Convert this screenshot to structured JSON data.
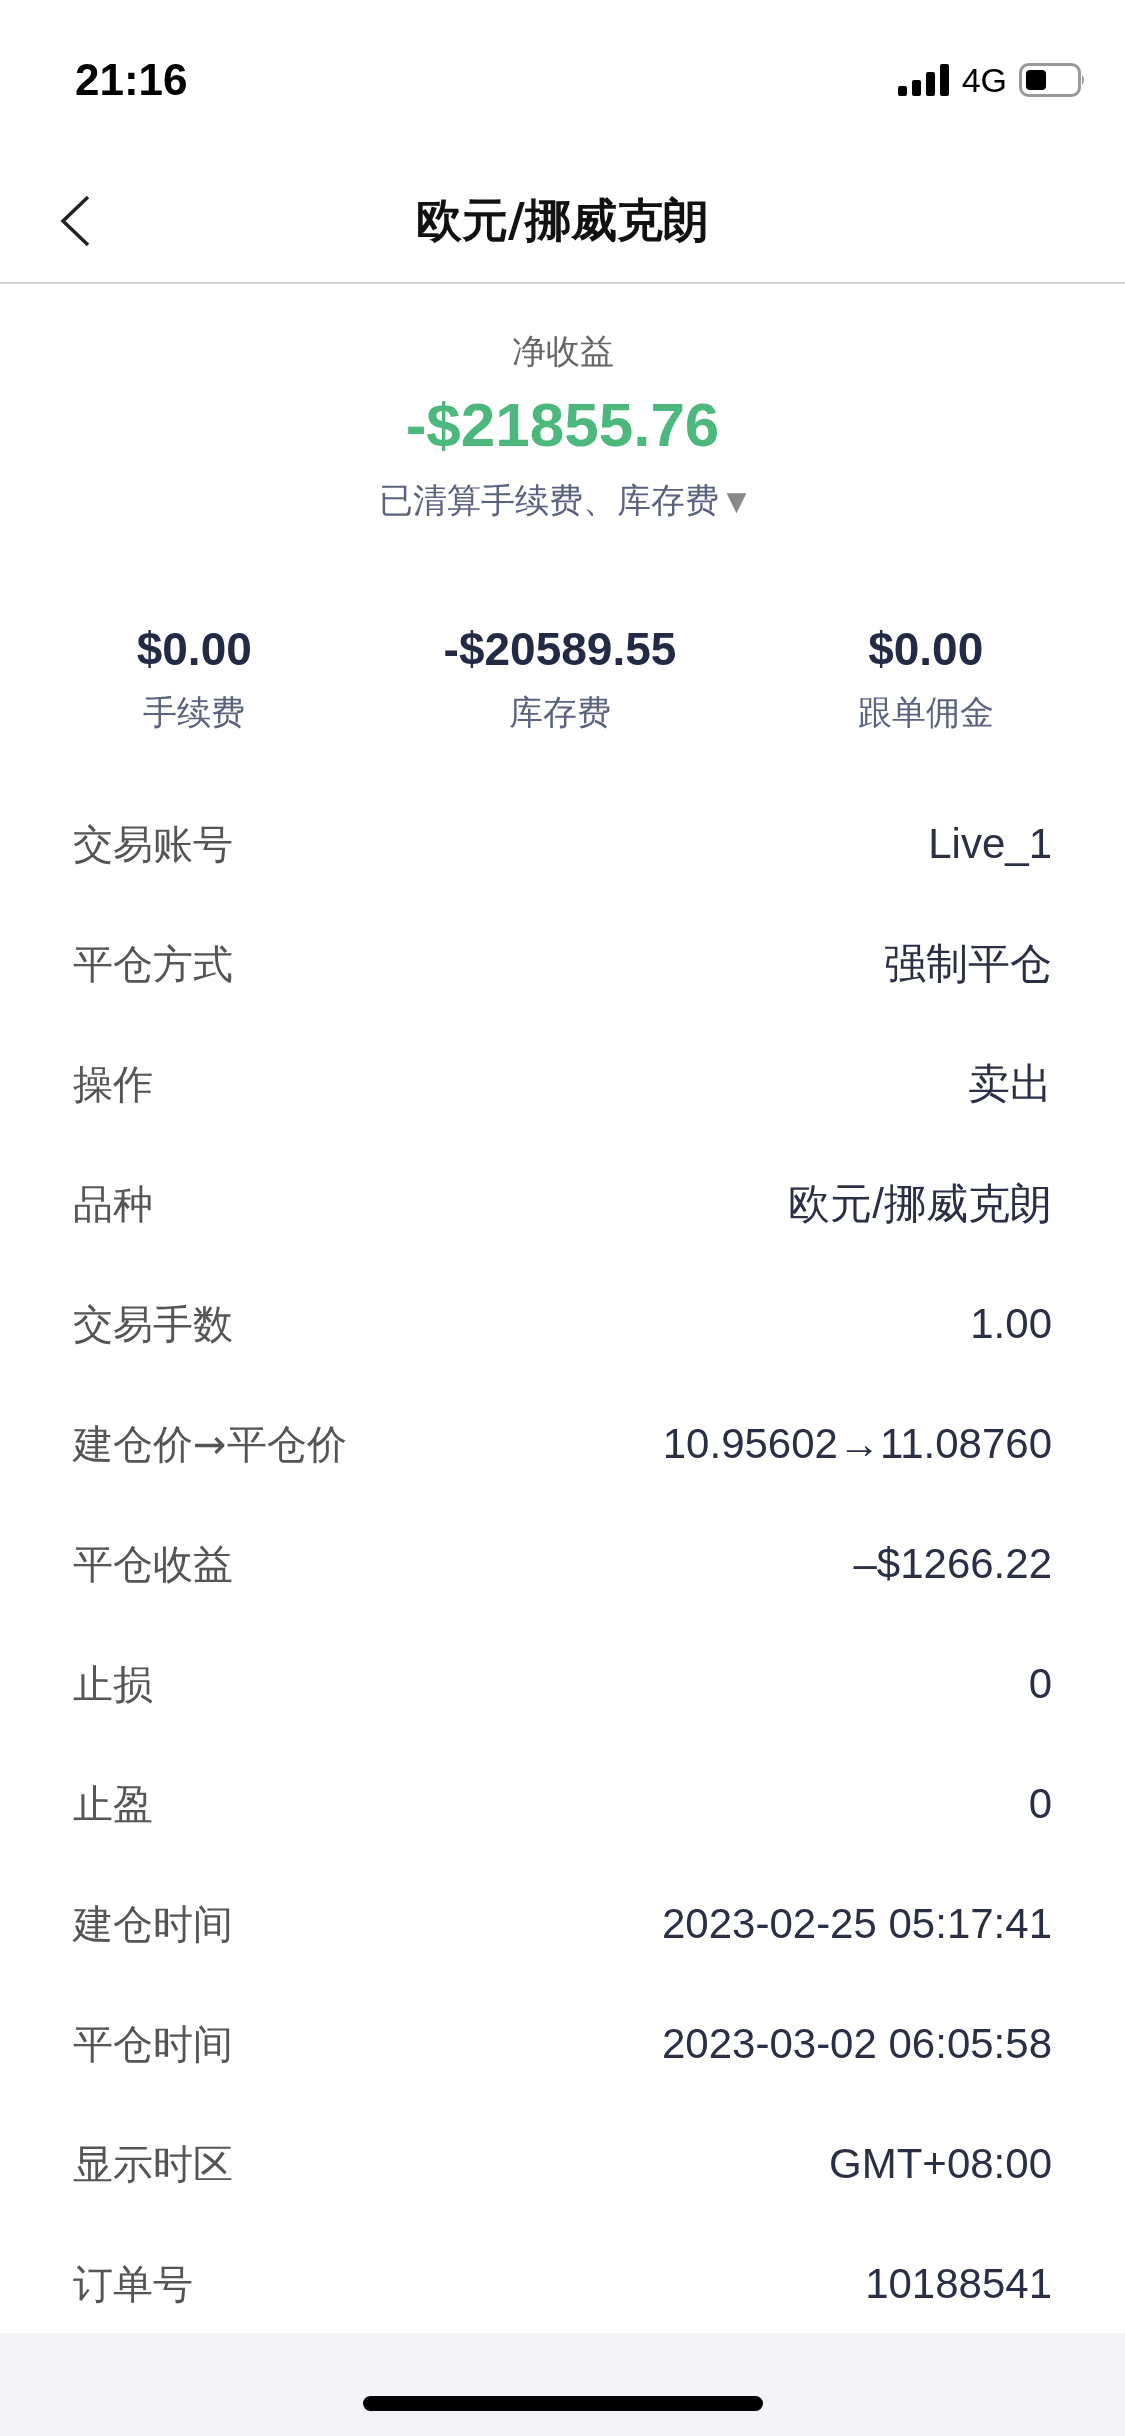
{
  "status_bar": {
    "time": "21:16",
    "network": "4G"
  },
  "header": {
    "title": "欧元/挪威克朗"
  },
  "summary": {
    "label": "净收益",
    "amount": "-$21855.76",
    "note": "已清算手续费、库存费",
    "note_icon": "▼"
  },
  "stats": [
    {
      "value": "$0.00",
      "label": "手续费"
    },
    {
      "value": "-$20589.55",
      "label": "库存费"
    },
    {
      "value": "$0.00",
      "label": "跟单佣金"
    }
  ],
  "details": [
    {
      "label": "交易账号",
      "value": "Live_1"
    },
    {
      "label": "平仓方式",
      "value": "强制平仓"
    },
    {
      "label": "操作",
      "value": "卖出"
    },
    {
      "label": "品种",
      "value": "欧元/挪威克朗"
    },
    {
      "label": "交易手数",
      "value": "1.00"
    },
    {
      "label": "建仓价→平仓价",
      "value": "10.95602→11.08760"
    },
    {
      "label": "平仓收益",
      "value": "–$1266.22"
    },
    {
      "label": "止损",
      "value": "0"
    },
    {
      "label": "止盈",
      "value": "0"
    },
    {
      "label": "建仓时间",
      "value": "2023-02-25 05:17:41"
    },
    {
      "label": "平仓时间",
      "value": "2023-03-02 06:05:58"
    },
    {
      "label": "显示时区",
      "value": "GMT+08:00"
    },
    {
      "label": "订单号",
      "value": "10188541"
    }
  ]
}
